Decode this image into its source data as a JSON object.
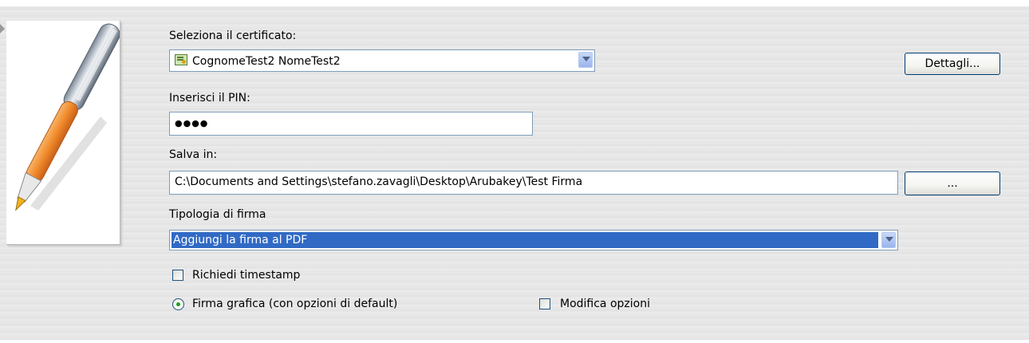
{
  "certificate": {
    "label": "Seleziona il certificato:",
    "selected": "CognomeTest2 NomeTest2",
    "details_button": "Dettagli..."
  },
  "pin": {
    "label": "Inserisci il PIN:",
    "masked_value": "●●●●"
  },
  "save": {
    "label": "Salva in:",
    "path": "C:\\Documents and Settings\\stefano.zavagli\\Desktop\\Arubakey\\Test Firma",
    "browse_button": "..."
  },
  "signature_type": {
    "label": "Tipologia di firma",
    "selected": "Aggiungi la firma al PDF"
  },
  "options": {
    "timestamp_label": "Richiedi timestamp",
    "timestamp_checked": false,
    "graphic_signature_label": "Firma grafica (con opzioni di default)",
    "graphic_signature_selected": true,
    "modify_options_label": "Modifica opzioni",
    "modify_options_checked": false
  },
  "icons": {
    "logo": "pen-signature-icon",
    "certificate": "certificate-icon",
    "dropdown": "chevron-down-icon"
  }
}
